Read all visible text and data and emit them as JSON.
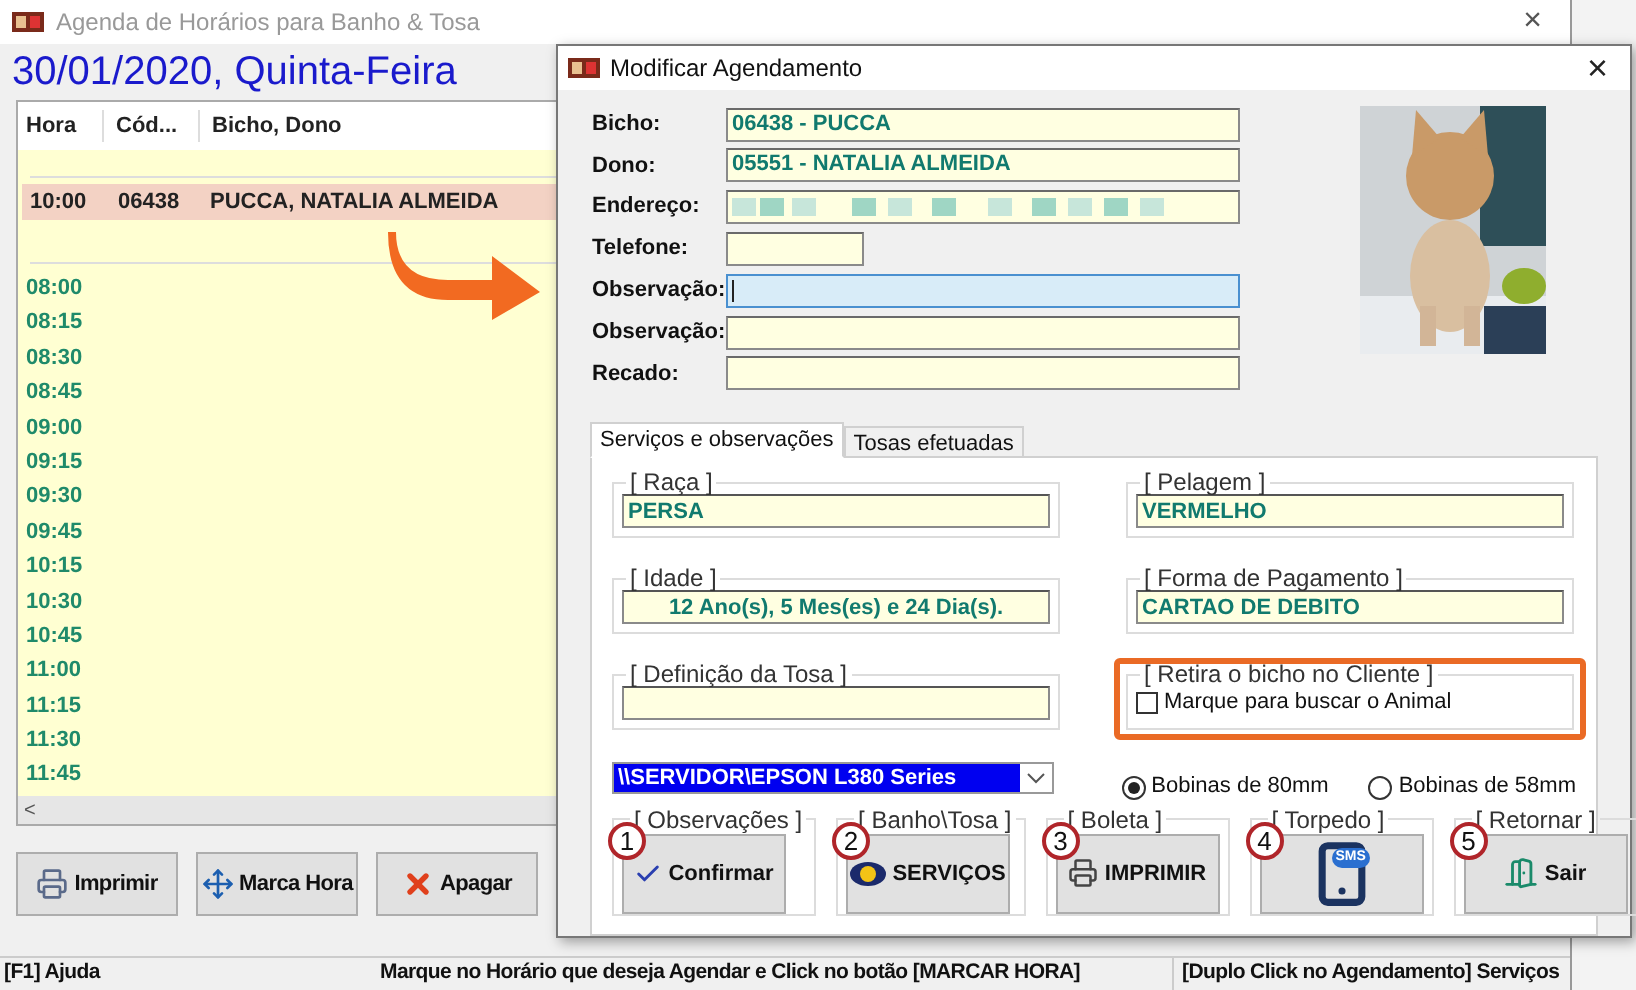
{
  "main_window": {
    "title": "Agenda de Horários para Banho & Tosa",
    "close": "×",
    "date": "30/01/2020, Quinta-Feira",
    "columns": [
      "Hora",
      "Cód...",
      "Bicho, Dono"
    ],
    "appointments": [
      {
        "hora": "10:00",
        "codigo": "06438",
        "bicho_dono": "PUCCA, NATALIA ALMEIDA",
        "selected": true
      }
    ],
    "slots": [
      "08:00",
      "08:15",
      "08:30",
      "08:45",
      "09:00",
      "09:15",
      "09:30",
      "09:45",
      "10:15",
      "10:30",
      "10:45",
      "11:00",
      "11:15",
      "11:30",
      "11:45"
    ],
    "scroll_left": "<",
    "buttons": [
      {
        "kind": "print",
        "label": "Imprimir"
      },
      {
        "kind": "mark",
        "label": "Marca Hora"
      },
      {
        "kind": "delete",
        "label": "Apagar"
      }
    ],
    "status_bar": [
      "[F1] Ajuda",
      "Marque no Horário que deseja Agendar e Click no botão [MARCAR HORA]",
      "[Duplo Click no Agendamento] Serviços"
    ]
  },
  "dialog": {
    "title": "Modificar Agendamento",
    "close": "×",
    "fields": [
      {
        "label": "Bicho:",
        "value": "06438 - PUCCA",
        "kind": "text",
        "focused": false,
        "blurred": false
      },
      {
        "label": "Dono:",
        "value": "05551 - NATALIA ALMEIDA",
        "kind": "text",
        "focused": false,
        "blurred": false
      },
      {
        "label": "Endereço:",
        "kind": "text",
        "focused": false,
        "blurred": true
      },
      {
        "label": "Telefone:",
        "kind": "phone",
        "focused": false,
        "blurred": false
      },
      {
        "label": "Observação:",
        "kind": "text",
        "focused": true,
        "blurred": false
      },
      {
        "label": "Observação:",
        "kind": "text",
        "focused": false,
        "blurred": false
      },
      {
        "label": "Recado:",
        "kind": "text",
        "focused": false,
        "blurred": false
      }
    ],
    "tabs": [
      {
        "label": "Serviços e observações",
        "selected": true
      },
      {
        "label": "Tosas efetuadas",
        "selected": false
      }
    ],
    "groups": [
      {
        "title": "[ Raça ]",
        "value": "PERSA",
        "kind": "text"
      },
      {
        "title": "[ Pelagem ]",
        "value": "VERMELHO",
        "kind": "text"
      },
      {
        "title": "[ Idade ]",
        "value": "12 Ano(s), 5 Mes(es) e 24 Dia(s).",
        "kind": "computed"
      },
      {
        "title": "[ Forma de Pagamento ]",
        "value": "CARTAO DE DEBITO",
        "kind": "text"
      },
      {
        "title": "[ Definição da Tosa ]",
        "kind": "text"
      }
    ],
    "pickup": {
      "title": "[ Retira o bicho no Cliente ]",
      "checkbox": {
        "label": "Marque para buscar o Animal",
        "checked": false
      },
      "highlighted": true
    },
    "printer": {
      "value": "\\\\SERVIDOR\\EPSON L380 Series"
    },
    "paper": [
      {
        "label": "Bobinas de 80mm",
        "selected": true
      },
      {
        "label": "Bobinas de 58mm",
        "selected": false
      }
    ],
    "actions": [
      {
        "kind": "confirm",
        "group": "[ Observações ]",
        "label": "Confirmar",
        "marker": "1"
      },
      {
        "kind": "services",
        "group": "[ Banho\\Tosa ]",
        "label": "SERVIÇOS",
        "marker": "2"
      },
      {
        "kind": "print",
        "group": "[ Boleta ]",
        "label": "IMPRIMIR",
        "marker": "3"
      },
      {
        "kind": "sms",
        "group": "[ Torpedo ]",
        "label": "SMS",
        "marker": "4"
      },
      {
        "kind": "exit",
        "group": "[ Retornar ]",
        "label": "Sair",
        "marker": "5"
      }
    ]
  }
}
